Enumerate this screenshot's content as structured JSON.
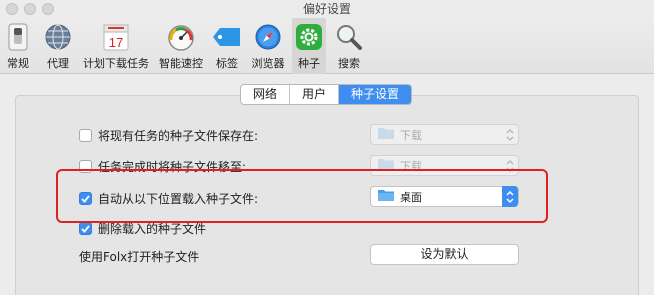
{
  "window": {
    "title": "偏好设置"
  },
  "toolbar": {
    "items": [
      {
        "label": "常规",
        "icon": "general-switch-icon"
      },
      {
        "label": "代理",
        "icon": "globe-icon"
      },
      {
        "label": "计划下载任务",
        "icon": "calendar-icon",
        "calendar_day": "17"
      },
      {
        "label": "智能速控",
        "icon": "speedometer-icon"
      },
      {
        "label": "标签",
        "icon": "tag-icon"
      },
      {
        "label": "浏览器",
        "icon": "compass-icon"
      },
      {
        "label": "种子",
        "icon": "gear-icon"
      },
      {
        "label": "搜索",
        "icon": "magnifier-icon"
      }
    ],
    "selected": "种子"
  },
  "tabs": {
    "network": "网络",
    "user": "用户",
    "torrent": "种子设置",
    "active": "种子设置"
  },
  "settings": {
    "save_torrent": {
      "label": "将现有任务的种子文件保存在:",
      "checked": false,
      "folder": "下载"
    },
    "move_torrent": {
      "label": "任务完成时将种子文件移至:",
      "checked": false,
      "folder": "下载"
    },
    "autoload_torrent": {
      "label": "自动从以下位置载入种子文件:",
      "checked": true,
      "folder": "桌面"
    },
    "delete_loaded": {
      "label": "删除载入的种子文件",
      "checked": true
    },
    "open_with_folx": {
      "label": "使用Folx打开种子文件",
      "button": "设为默认"
    }
  },
  "colors": {
    "accent": "#3d8ef0",
    "highlight_box": "#dd2222"
  }
}
